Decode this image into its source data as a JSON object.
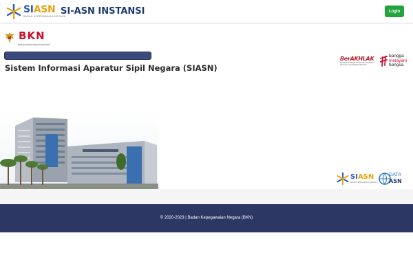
{
  "navbar": {
    "brand_prefix": "SI",
    "brand_suffix": "ASN",
    "brand_tagline": "BADAN KEPEGAWAIAN NEGARA",
    "title": "SI-ASN INSTANSI",
    "login_label": "Login",
    "login_color": "#22a33c"
  },
  "hero": {
    "bkn_logo_text": "BKN",
    "bkn_logo_subtitle": "BADAN KEPEGAWAIAN NEGARA",
    "berakhlak_title": "BerAKHLAK",
    "berakhlak_subtitle": "Berorientasi Pelayanan Akuntabel Kompeten Harmonis Loyal Adaptif Kolaboratif",
    "bangga_line1": "bangga",
    "bangga_line2": "melayani",
    "bangga_line3": "bangsa",
    "title": "Sistem Informasi Aparatur Sipil Negara (SIASN)",
    "progress_bar_color": "#3b4a7a"
  },
  "bottom_logos": {
    "siasn_prefix": "SI",
    "siasn_suffix": "ASN",
    "siasn_tagline": "BADAN KEPEGAWAIAN NEGARA",
    "data_line1": "DATA",
    "data_line2": "ASN"
  },
  "footer": {
    "copyright": "© 2020-2023 | Badan Kepegawaian Negara (BKN)",
    "background": "#2c3764"
  }
}
